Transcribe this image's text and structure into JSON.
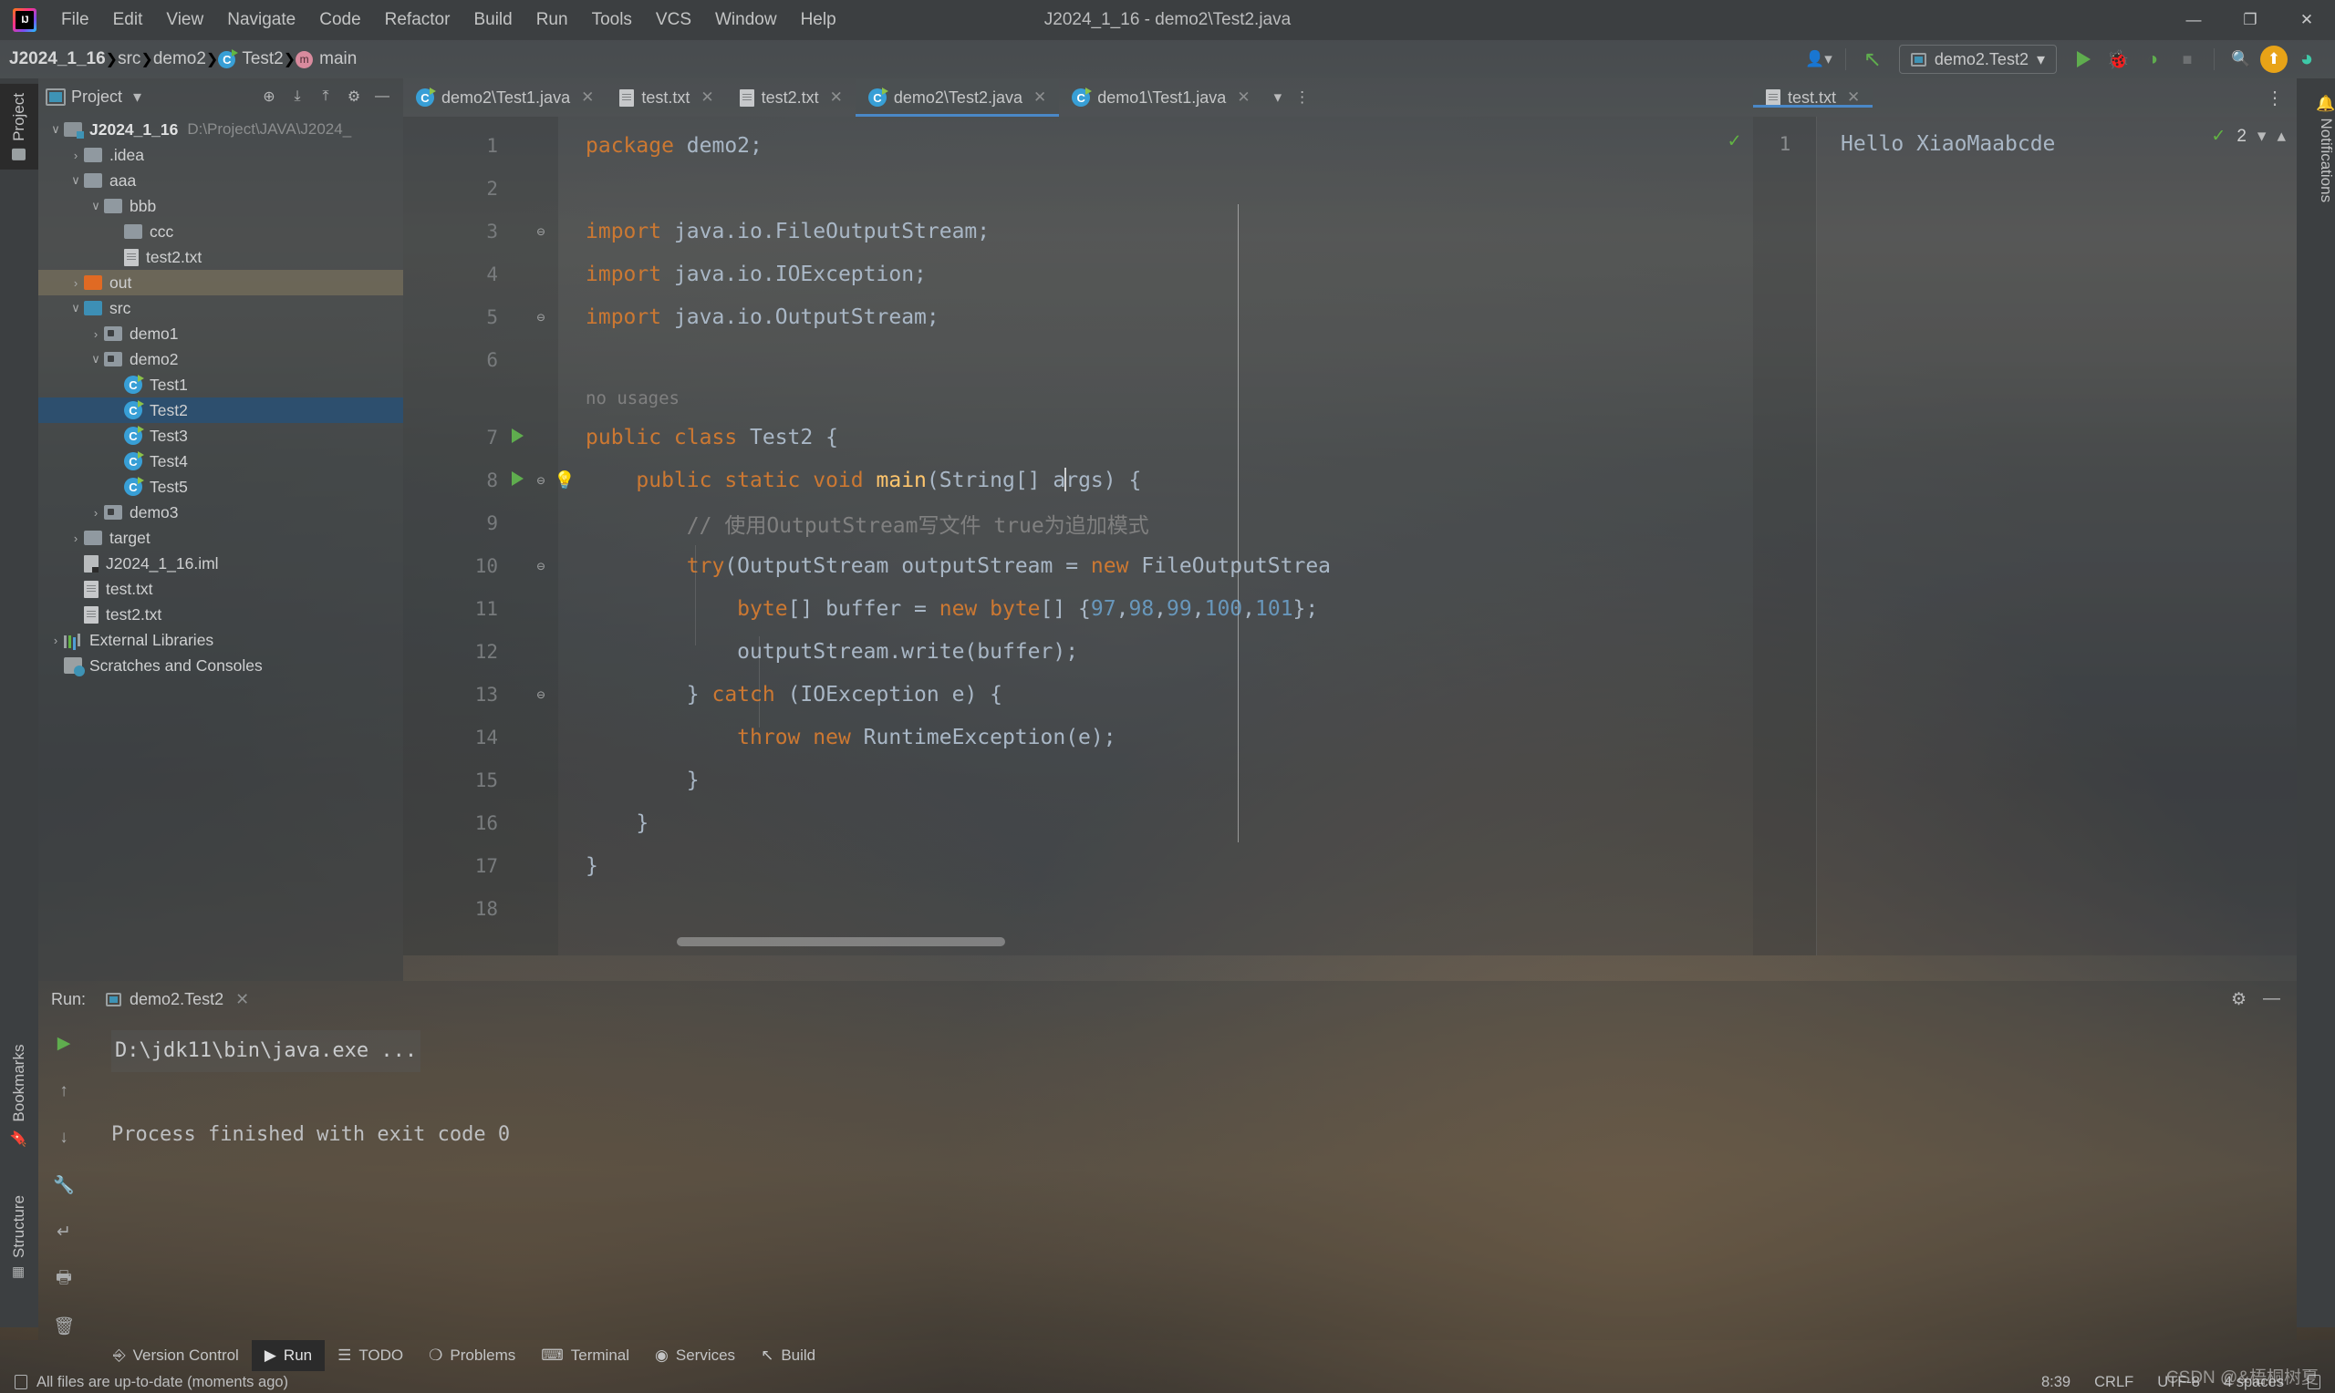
{
  "window": {
    "title": "J2024_1_16 - demo2\\Test2.java",
    "logo_icon": "intellij-idea-logo",
    "controls": {
      "minimize": "—",
      "maximize": "❐",
      "close": "✕"
    }
  },
  "menu": [
    "File",
    "Edit",
    "View",
    "Navigate",
    "Code",
    "Refactor",
    "Build",
    "Run",
    "Tools",
    "VCS",
    "Window",
    "Help"
  ],
  "breadcrumb": [
    {
      "label": "J2024_1_16",
      "icon": "",
      "bold": true
    },
    {
      "label": "src",
      "icon": ""
    },
    {
      "label": "demo2",
      "icon": ""
    },
    {
      "label": "Test2",
      "icon": "java-class-icon"
    },
    {
      "label": "main",
      "icon": "java-method-icon"
    }
  ],
  "nav_toolbar": {
    "run_config_name": "demo2.Test2",
    "buttons": [
      {
        "name": "user-avatar-dropdown",
        "glyph": "👤▾"
      },
      {
        "name": "build-hammer-icon",
        "glyph": "↖"
      },
      {
        "name": "run-button",
        "glyph": "▶"
      },
      {
        "name": "debug-button",
        "glyph": "🐞"
      },
      {
        "name": "run-with-coverage-button",
        "glyph": "◑"
      },
      {
        "name": "stop-button",
        "glyph": "■"
      },
      {
        "name": "search-everywhere-icon",
        "glyph": "🔍"
      },
      {
        "name": "update-project-icon",
        "glyph": "⬆"
      },
      {
        "name": "ide-assistant-icon",
        "glyph": "◕"
      }
    ]
  },
  "left_strip": [
    {
      "label": "Project",
      "icon": "project-icon",
      "active": true
    },
    {
      "label": "Bookmarks",
      "icon": "bookmark-icon",
      "active": false
    },
    {
      "label": "Structure",
      "icon": "structure-icon",
      "active": false
    }
  ],
  "right_strip": [
    {
      "label": "Notifications",
      "icon": "bell-icon"
    }
  ],
  "project_panel": {
    "title": "Project",
    "dropdown_glyph": "▾",
    "tools": [
      {
        "name": "select-opened-file-icon",
        "glyph": "⊕"
      },
      {
        "name": "expand-all-icon",
        "glyph": "⤓"
      },
      {
        "name": "collapse-all-icon",
        "glyph": "⤒"
      },
      {
        "name": "settings-gear-icon",
        "glyph": "⚙"
      },
      {
        "name": "hide-panel-icon",
        "glyph": "—"
      }
    ],
    "tree": [
      {
        "label": "J2024_1_16",
        "path": "D:\\Project\\JAVA\\J2024_",
        "arrow": "∨",
        "indent": 0,
        "icon": "module-icon",
        "bold": true
      },
      {
        "label": ".idea",
        "arrow": "›",
        "indent": 1,
        "icon": "folder-grey"
      },
      {
        "label": "aaa",
        "arrow": "∨",
        "indent": 1,
        "icon": "folder-grey"
      },
      {
        "label": "bbb",
        "arrow": "∨",
        "indent": 2,
        "icon": "folder-grey"
      },
      {
        "label": "ccc",
        "arrow": "",
        "indent": 3,
        "icon": "folder-grey"
      },
      {
        "label": "test2.txt",
        "arrow": "",
        "indent": 3,
        "icon": "text-file-icon"
      },
      {
        "label": "out",
        "arrow": "›",
        "indent": 1,
        "icon": "folder-orange",
        "highlight": true
      },
      {
        "label": "src",
        "arrow": "∨",
        "indent": 1,
        "icon": "folder-blue"
      },
      {
        "label": "demo1",
        "arrow": "›",
        "indent": 2,
        "icon": "package-icon"
      },
      {
        "label": "demo2",
        "arrow": "∨",
        "indent": 2,
        "icon": "package-icon"
      },
      {
        "label": "Test1",
        "arrow": "",
        "indent": 3,
        "icon": "java-class-icon"
      },
      {
        "label": "Test2",
        "arrow": "",
        "indent": 3,
        "icon": "java-class-icon",
        "selected": true
      },
      {
        "label": "Test3",
        "arrow": "",
        "indent": 3,
        "icon": "java-class-icon"
      },
      {
        "label": "Test4",
        "arrow": "",
        "indent": 3,
        "icon": "java-class-icon"
      },
      {
        "label": "Test5",
        "arrow": "",
        "indent": 3,
        "icon": "java-class-icon"
      },
      {
        "label": "demo3",
        "arrow": "›",
        "indent": 2,
        "icon": "package-icon"
      },
      {
        "label": "target",
        "arrow": "›",
        "indent": 1,
        "icon": "folder-grey"
      },
      {
        "label": "J2024_1_16.iml",
        "arrow": "",
        "indent": 1,
        "icon": "iml-file-icon"
      },
      {
        "label": "test.txt",
        "arrow": "",
        "indent": 1,
        "icon": "text-file-icon"
      },
      {
        "label": "test2.txt",
        "arrow": "",
        "indent": 1,
        "icon": "text-file-icon"
      },
      {
        "label": "External Libraries",
        "arrow": "›",
        "indent": 0,
        "icon": "libraries-icon"
      },
      {
        "label": "Scratches and Consoles",
        "arrow": "",
        "indent": 0,
        "icon": "scratches-icon"
      }
    ]
  },
  "editor_tabs_left": [
    {
      "label": "demo2\\Test1.java",
      "icon": "java-class-icon",
      "active": false
    },
    {
      "label": "test.txt",
      "icon": "text-file-icon",
      "active": false
    },
    {
      "label": "test2.txt",
      "icon": "text-file-icon",
      "active": false
    },
    {
      "label": "demo2\\Test2.java",
      "icon": "java-class-icon",
      "active": true
    },
    {
      "label": "demo1\\Test1.java",
      "icon": "java-class-icon",
      "active": false
    }
  ],
  "editor_tabs_right": [
    {
      "label": "test.txt",
      "icon": "text-file-icon",
      "active": true
    }
  ],
  "editor": {
    "inlay_hint": "no usages",
    "lines": [
      {
        "n": "1",
        "html": "<span class='kw'>package</span> demo2;"
      },
      {
        "n": "2",
        "html": ""
      },
      {
        "n": "3",
        "html": "<span class='kw'>import</span> java.io.FileOutputStream;",
        "fold": "⊖"
      },
      {
        "n": "4",
        "html": "<span class='kw'>import</span> java.io.IOException;"
      },
      {
        "n": "5",
        "html": "<span class='kw'>import</span> java.io.OutputStream;",
        "fold": "⊖"
      },
      {
        "n": "6",
        "html": ""
      },
      {
        "n": "7",
        "html": "<span class='kw'>public class</span> Test2 {",
        "run": true
      },
      {
        "n": "8",
        "html": "    <span class='kw'>public static void</span> <span class='meth'>main</span>(String[] a<span class='caret'></span>rgs) {",
        "run": true,
        "fold": "⊖",
        "bulb": true
      },
      {
        "n": "9",
        "html": "        <span class='cmt'>// 使用OutputStream写文件 true为追加模式</span>"
      },
      {
        "n": "10",
        "html": "        <span class='kw'>try</span>(OutputStream outputStream = <span class='kw'>new</span> FileOutputStrea",
        "fold": "⊖"
      },
      {
        "n": "11",
        "html": "            <span class='kw'>byte</span>[] buffer = <span class='kw'>new byte</span>[] {<span class='num'>97</span>,<span class='num'>98</span>,<span class='num'>99</span>,<span class='num'>100</span>,<span class='num'>101</span>};"
      },
      {
        "n": "12",
        "html": "            outputStream.write(buffer);"
      },
      {
        "n": "13",
        "html": "        } <span class='kw'>catch</span> (IOException e) {",
        "fold": "⊖"
      },
      {
        "n": "14",
        "html": "            <span class='kw'>throw new</span> RuntimeException(e);"
      },
      {
        "n": "15",
        "html": "        }"
      },
      {
        "n": "16",
        "html": "    }"
      },
      {
        "n": "17",
        "html": "}"
      },
      {
        "n": "18",
        "html": ""
      }
    ]
  },
  "editor_right": {
    "line_number": "1",
    "content": "Hello XiaoMaabcde",
    "warning_count": "2"
  },
  "run_panel": {
    "label": "Run:",
    "tab_name": "demo2.Test2",
    "close_glyph": "✕",
    "header_right": [
      {
        "name": "settings-gear-icon",
        "glyph": "⚙"
      },
      {
        "name": "hide-panel-icon",
        "glyph": "—"
      }
    ],
    "tools": [
      {
        "name": "rerun-button",
        "glyph": "▶",
        "green": true
      },
      {
        "name": "scroll-up-button",
        "glyph": "↑"
      },
      {
        "name": "scroll-down-button",
        "glyph": "↓"
      },
      {
        "name": "wrench-settings-icon",
        "glyph": "🔧"
      },
      {
        "name": "soft-wrap-icon",
        "glyph": "↵"
      },
      {
        "name": "print-icon",
        "glyph": "🖶"
      },
      {
        "name": "clear-all-icon",
        "glyph": "🗑"
      }
    ],
    "console_lines": [
      {
        "text": "D:\\jdk11\\bin\\java.exe ...",
        "cmd": true
      },
      {
        "text": "",
        "cmd": false
      },
      {
        "text": "Process finished with exit code 0",
        "cmd": false
      }
    ]
  },
  "bottom_strip": [
    {
      "label": "Version Control",
      "icon": "branch-icon",
      "active": false
    },
    {
      "label": "Run",
      "icon": "run-icon",
      "active": true
    },
    {
      "label": "TODO",
      "icon": "todo-list-icon",
      "active": false
    },
    {
      "label": "Problems",
      "icon": "problems-icon",
      "active": false
    },
    {
      "label": "Terminal",
      "icon": "terminal-icon",
      "active": false
    },
    {
      "label": "Services",
      "icon": "services-icon",
      "active": false
    },
    {
      "label": "Build",
      "icon": "build-hammer-icon",
      "active": false
    }
  ],
  "status_bar": {
    "message": "All files are up-to-date (moments ago)",
    "message_icon": "document-icon",
    "caret_position": "8:39",
    "line_separator": "CRLF",
    "encoding": "UTF-8",
    "indent": "4 spaces",
    "lock_icon": "read-only-toggle-icon"
  },
  "watermark": "CSDN @&梧桐树夏",
  "colors": {
    "chrome": "#3c3f41",
    "accent_blue": "#4a88c7",
    "selection": "#2d4f6e",
    "keyword": "#cc7832",
    "number": "#6897bb",
    "comment": "#808080",
    "method": "#ffc66d",
    "green": "#62b543",
    "text": "#a9b7c6"
  }
}
